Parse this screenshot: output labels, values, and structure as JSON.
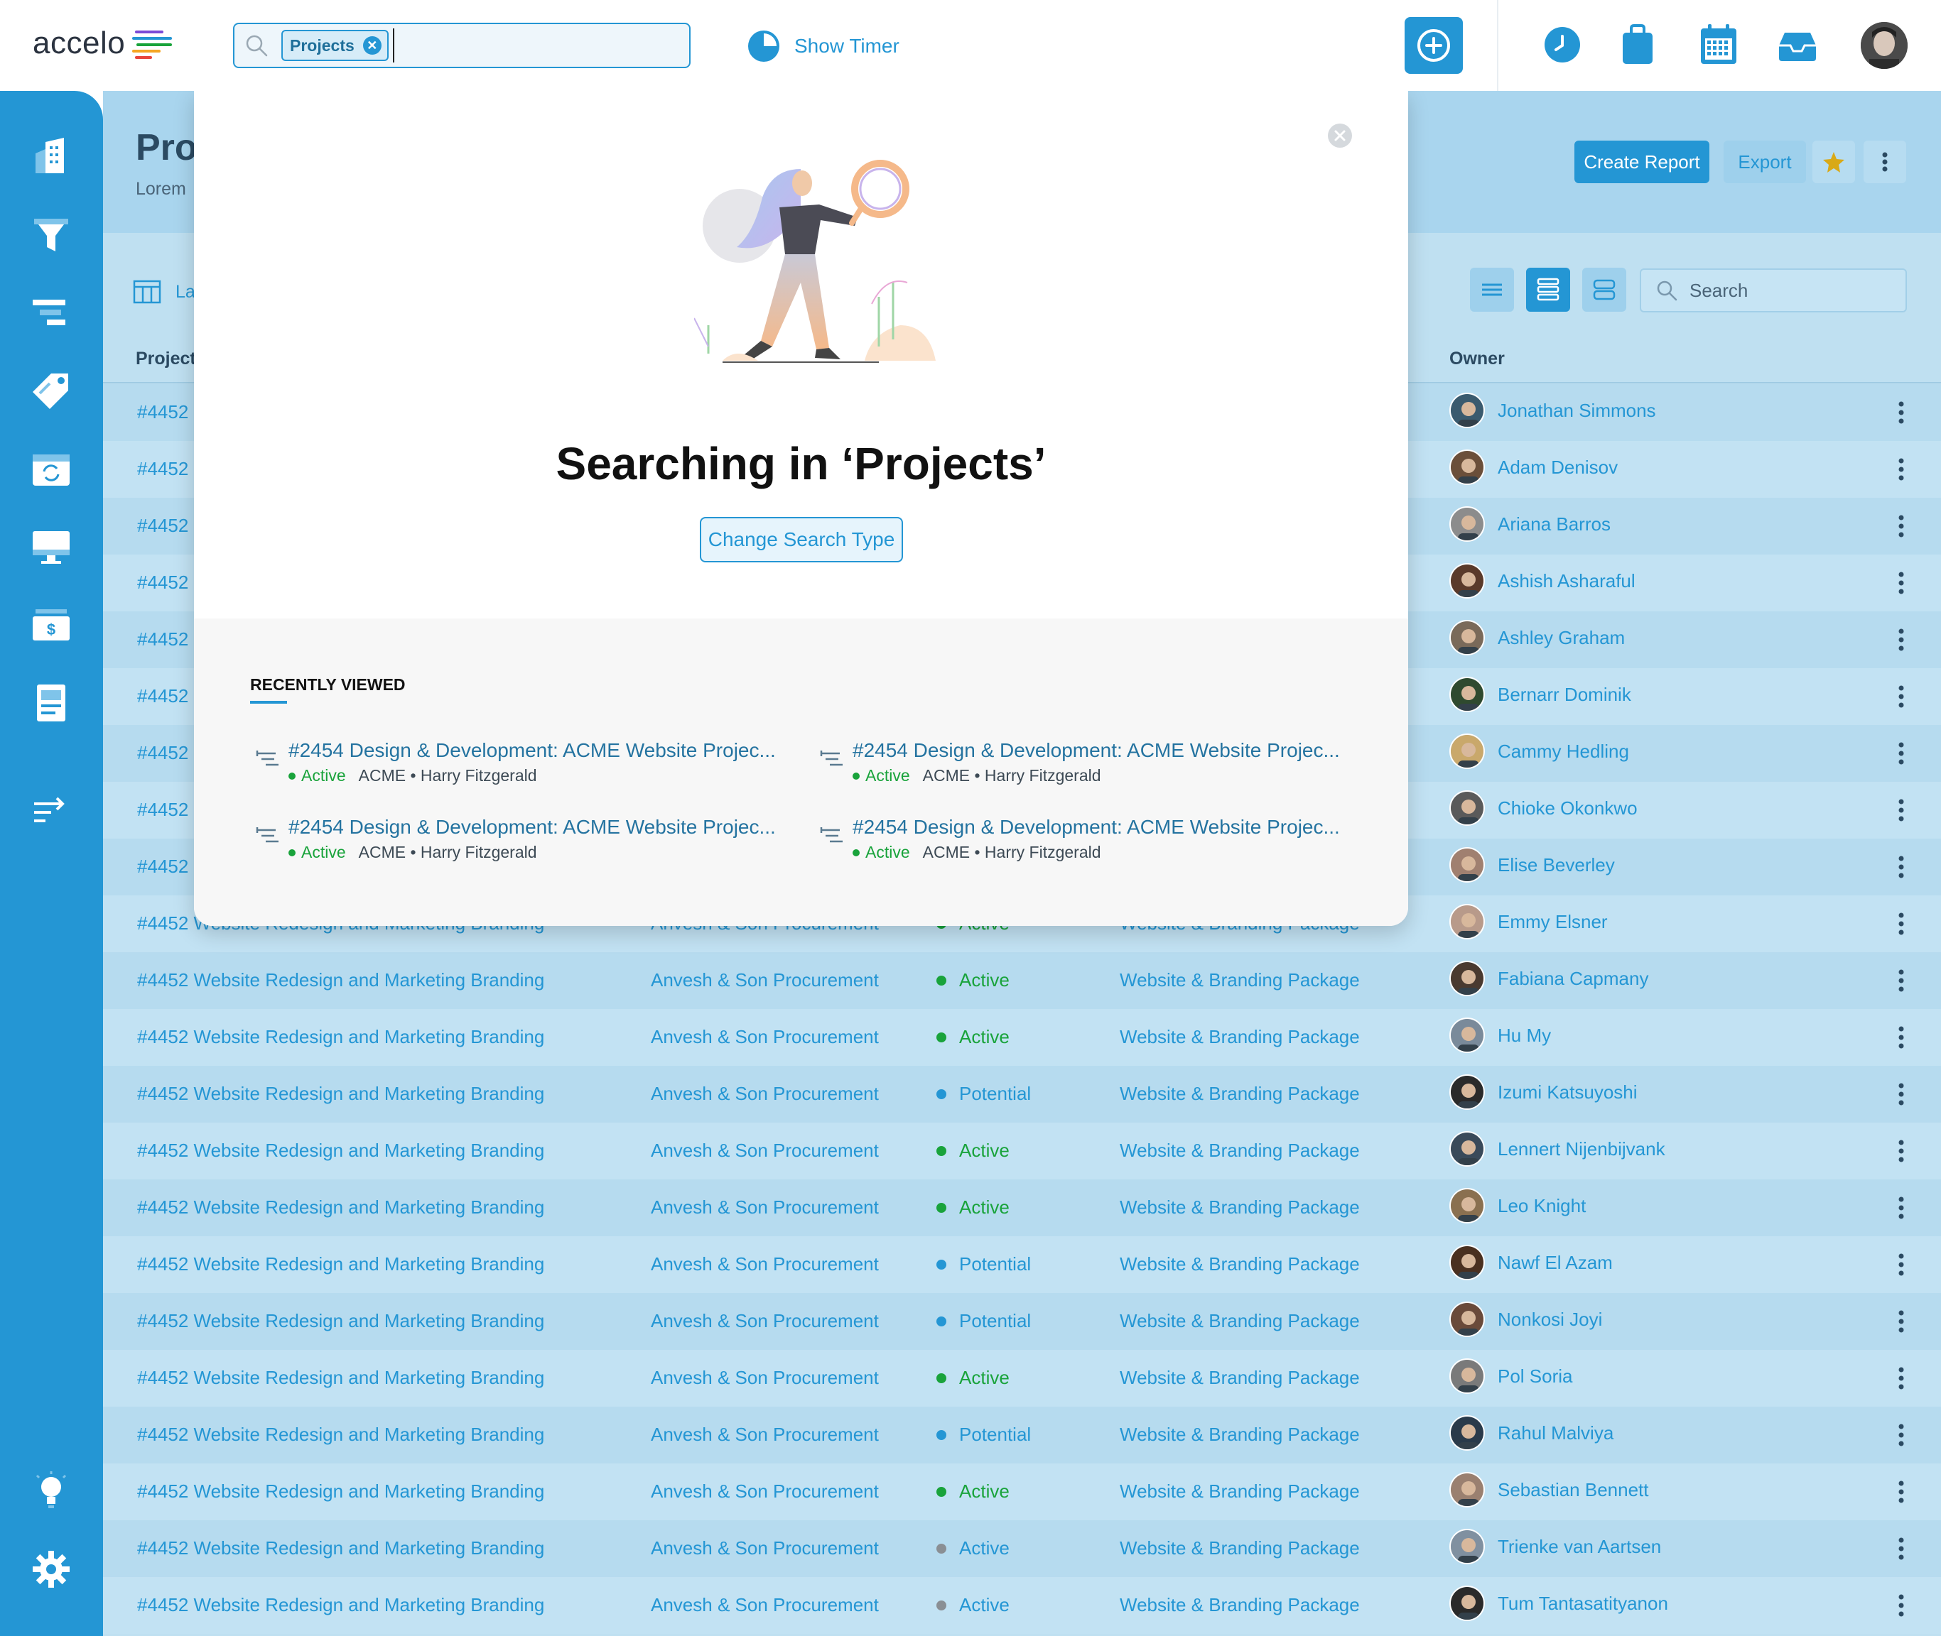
{
  "app": {
    "logo_text": "accelo"
  },
  "topbar": {
    "search_chip": "Projects",
    "show_timer": "Show Timer",
    "icons": [
      "clock-icon",
      "briefcase-icon",
      "calendar-icon",
      "inbox-icon",
      "user-avatar"
    ]
  },
  "sidebar": {
    "items": [
      "companies-icon",
      "sales-funnel-icon",
      "projects-icon",
      "tickets-icon",
      "retainers-icon",
      "desktop-icon",
      "billing-icon",
      "reports-icon",
      "transfer-icon",
      "lightbulb-icon",
      "settings-icon"
    ]
  },
  "page": {
    "title": "Pro",
    "subtitle": "Lorem",
    "create_report": "Create Report",
    "export": "Export",
    "layout_label": "La",
    "search_placeholder": "Search",
    "col_project": "Project",
    "col_owner": "Owner"
  },
  "rows": [
    {
      "project": "#4452",
      "client": "",
      "status": "",
      "type": "",
      "owner": "Jonathan Simmons"
    },
    {
      "project": "#4452",
      "client": "",
      "status": "",
      "type": "",
      "owner": "Adam Denisov"
    },
    {
      "project": "#4452",
      "client": "",
      "status": "",
      "type": "",
      "owner": "Ariana Barros"
    },
    {
      "project": "#4452",
      "client": "",
      "status": "",
      "type": "",
      "owner": "Ashish Asharaful"
    },
    {
      "project": "#4452",
      "client": "",
      "status": "",
      "type": "",
      "owner": "Ashley Graham"
    },
    {
      "project": "#4452",
      "client": "",
      "status": "",
      "type": "",
      "owner": "Bernarr Dominik"
    },
    {
      "project": "#4452",
      "client": "",
      "status": "",
      "type": "",
      "owner": "Cammy Hedling"
    },
    {
      "project": "#4452",
      "client": "",
      "status": "",
      "type": "",
      "owner": "Chioke Okonkwo"
    },
    {
      "project": "#4452",
      "client": "",
      "status": "",
      "type": "",
      "owner": "Elise Beverley"
    },
    {
      "project": "#4452 Website Redesign and Marketing Branding",
      "client": "Anvesh & Son Procurement",
      "status": "Active",
      "type": "Website & Branding Package",
      "owner": "Emmy Elsner"
    },
    {
      "project": "#4452 Website Redesign and Marketing Branding",
      "client": "Anvesh & Son Procurement",
      "status": "Active",
      "type": "Website & Branding Package",
      "owner": "Fabiana Capmany"
    },
    {
      "project": "#4452 Website Redesign and Marketing Branding",
      "client": "Anvesh & Son Procurement",
      "status": "Active",
      "type": "Website & Branding Package",
      "owner": "Hu My"
    },
    {
      "project": "#4452 Website Redesign and Marketing Branding",
      "client": "Anvesh & Son Procurement",
      "status": "Potential",
      "type": "Website & Branding Package",
      "owner": "Izumi Katsuyoshi"
    },
    {
      "project": "#4452 Website Redesign and Marketing Branding",
      "client": "Anvesh & Son Procurement",
      "status": "Active",
      "type": "Website & Branding Package",
      "owner": "Lennert Nijenbijvank"
    },
    {
      "project": "#4452 Website Redesign and Marketing Branding",
      "client": "Anvesh & Son Procurement",
      "status": "Active",
      "type": "Website & Branding Package",
      "owner": "Leo Knight"
    },
    {
      "project": "#4452 Website Redesign and Marketing Branding",
      "client": "Anvesh & Son Procurement",
      "status": "Potential",
      "type": "Website & Branding Package",
      "owner": "Nawf El Azam"
    },
    {
      "project": "#4452 Website Redesign and Marketing Branding",
      "client": "Anvesh & Son Procurement",
      "status": "Potential",
      "type": "Website & Branding Package",
      "owner": "Nonkosi Joyi"
    },
    {
      "project": "#4452 Website Redesign and Marketing Branding",
      "client": "Anvesh & Son Procurement",
      "status": "Active",
      "type": "Website & Branding Package",
      "owner": "Pol Soria"
    },
    {
      "project": "#4452 Website Redesign and Marketing Branding",
      "client": "Anvesh & Son Procurement",
      "status": "Potential",
      "type": "Website & Branding Package",
      "owner": "Rahul Malviya"
    },
    {
      "project": "#4452 Website Redesign and Marketing Branding",
      "client": "Anvesh & Son Procurement",
      "status": "Active",
      "type": "Website & Branding Package",
      "owner": "Sebastian Bennett"
    },
    {
      "project": "#4452 Website Redesign and Marketing Branding",
      "client": "Anvesh & Son Procurement",
      "status": "Active",
      "type": "Website & Branding Package",
      "owner": "Trienke van Aartsen",
      "muted": true
    },
    {
      "project": "#4452 Website Redesign and Marketing Branding",
      "client": "Anvesh & Son Procurement",
      "status": "Active",
      "type": "Website & Branding Package",
      "owner": "Tum Tantasatityanon",
      "muted": true
    }
  ],
  "status_colors": {
    "Active": "#19a33b",
    "Potential": "#2496d4",
    "muted": "#8a8f94"
  },
  "modal": {
    "title": "Searching in ‘Projects’",
    "change_button": "Change Search Type",
    "recent_label": "RECENTLY VIEWED",
    "recent_items": [
      {
        "title": "#2454 Design & Development: ACME Website Projec...",
        "status": "Active",
        "meta": "ACME • Harry Fitzgerald"
      },
      {
        "title": "#2454 Design & Development: ACME Website Projec...",
        "status": "Active",
        "meta": "ACME • Harry Fitzgerald"
      },
      {
        "title": "#2454 Design & Development: ACME Website Projec...",
        "status": "Active",
        "meta": "ACME • Harry Fitzgerald"
      },
      {
        "title": "#2454 Design & Development: ACME Website Projec...",
        "status": "Active",
        "meta": "ACME • Harry Fitzgerald"
      }
    ]
  },
  "colors": {
    "brand": "#2496d4",
    "active": "#19a33b"
  }
}
